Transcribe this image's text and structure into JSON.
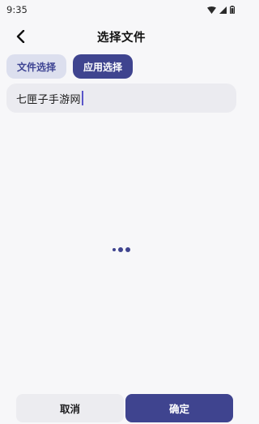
{
  "status_bar": {
    "time": "9:35"
  },
  "header": {
    "title": "选择文件",
    "back_icon": "back-arrow-icon"
  },
  "tabs": [
    {
      "label": "文件选择",
      "active": false
    },
    {
      "label": "应用选择",
      "active": true
    }
  ],
  "search": {
    "value": "七匣子手游网"
  },
  "footer": {
    "cancel_label": "取消",
    "confirm_label": "确定"
  },
  "colors": {
    "accent": "#3f448f",
    "tab_inactive_bg": "#dcdfee",
    "background": "#f7f7f9"
  }
}
